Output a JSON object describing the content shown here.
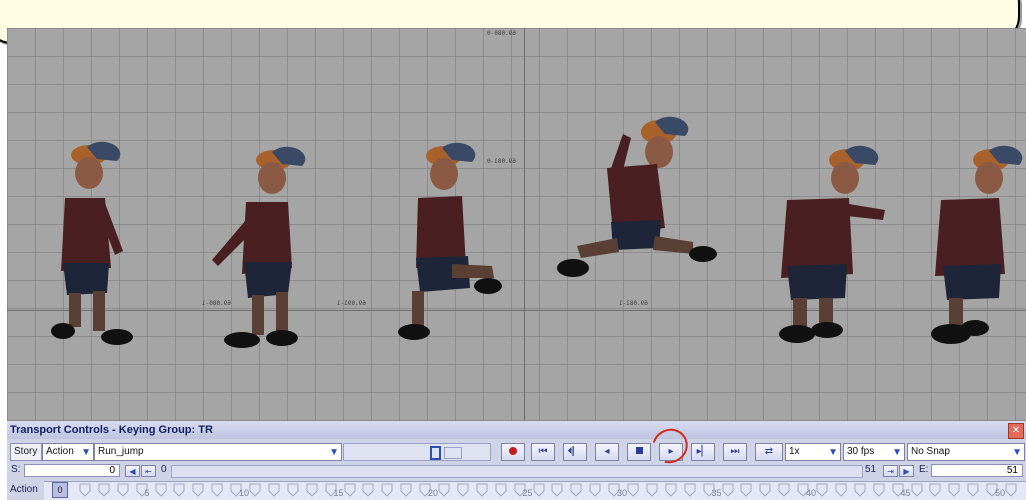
{
  "panel": {
    "title": "Transport Controls  -  Keying Group: TR",
    "close_icon": "close-icon"
  },
  "row1": {
    "tab_story": "Story",
    "mode_select": "Action",
    "take_select": "Run_jump",
    "speed_select": "1x",
    "fps_select": "30 fps",
    "snap_select": "No Snap"
  },
  "row2": {
    "start_label": "S:",
    "start_value": "0",
    "offset_value": "0",
    "end_frame_value": "51",
    "end_label": "E:",
    "end_value": "51"
  },
  "timeline": {
    "label": "Action",
    "current_frame": "0",
    "tick_labels": [
      "5",
      "10",
      "15",
      "20",
      "25",
      "30",
      "35",
      "40",
      "45",
      "50"
    ]
  },
  "viewport": {
    "grid_labels": [
      "69.080-0",
      "69.081-0",
      "69.091-1",
      "69.081-1",
      "69.080-1"
    ]
  },
  "colors": {
    "panel_bg": "#cfd3e6",
    "grid_bg": "#a5a5a5",
    "record": "#c41c1c",
    "accent": "#2b4db6"
  },
  "icons": [
    "record-icon",
    "go-start-icon",
    "prev-key-icon",
    "prev-frame-icon",
    "stop-icon",
    "play-icon",
    "next-key-icon",
    "go-end-icon",
    "loop-icon"
  ]
}
